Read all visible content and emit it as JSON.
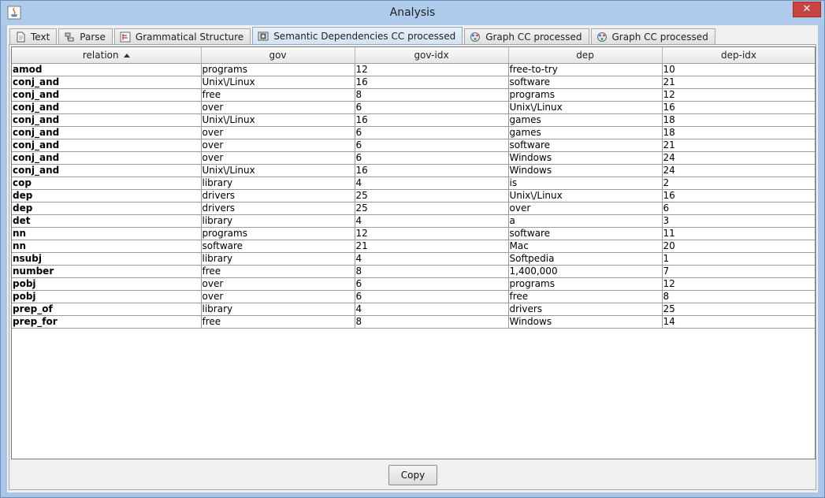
{
  "window": {
    "title": "Analysis",
    "close_label": "✕"
  },
  "tabs": [
    {
      "label": "Text",
      "icon": "document-icon",
      "active": false
    },
    {
      "label": "Parse",
      "icon": "parse-tree-icon",
      "active": false
    },
    {
      "label": "Grammatical Structure",
      "icon": "structure-icon",
      "active": false
    },
    {
      "label": "Semantic Dependencies CC processed",
      "icon": "dependencies-icon",
      "active": true
    },
    {
      "label": "Graph CC processed",
      "icon": "graph-icon",
      "active": false
    },
    {
      "label": "Graph CC processed",
      "icon": "graph-icon",
      "active": false
    }
  ],
  "table": {
    "columns": [
      "relation",
      "gov",
      "gov-idx",
      "dep",
      "dep-idx"
    ],
    "sort_column": "relation",
    "rows": [
      [
        "amod",
        "programs",
        "12",
        "free-to-try",
        "10"
      ],
      [
        "conj_and",
        "Unix\\/Linux",
        "16",
        "software",
        "21"
      ],
      [
        "conj_and",
        "free",
        "8",
        "programs",
        "12"
      ],
      [
        "conj_and",
        "over",
        "6",
        "Unix\\/Linux",
        "16"
      ],
      [
        "conj_and",
        "Unix\\/Linux",
        "16",
        "games",
        "18"
      ],
      [
        "conj_and",
        "over",
        "6",
        "games",
        "18"
      ],
      [
        "conj_and",
        "over",
        "6",
        "software",
        "21"
      ],
      [
        "conj_and",
        "over",
        "6",
        "Windows",
        "24"
      ],
      [
        "conj_and",
        "Unix\\/Linux",
        "16",
        "Windows",
        "24"
      ],
      [
        "cop",
        "library",
        "4",
        "is",
        "2"
      ],
      [
        "dep",
        "drivers",
        "25",
        "Unix\\/Linux",
        "16"
      ],
      [
        "dep",
        "drivers",
        "25",
        "over",
        "6"
      ],
      [
        "det",
        "library",
        "4",
        "a",
        "3"
      ],
      [
        "nn",
        "programs",
        "12",
        "software",
        "11"
      ],
      [
        "nn",
        "software",
        "21",
        "Mac",
        "20"
      ],
      [
        "nsubj",
        "library",
        "4",
        "Softpedia",
        "1"
      ],
      [
        "number",
        "free",
        "8",
        "1,400,000",
        "7"
      ],
      [
        "pobj",
        "over",
        "6",
        "programs",
        "12"
      ],
      [
        "pobj",
        "over",
        "6",
        "free",
        "8"
      ],
      [
        "prep_of",
        "library",
        "4",
        "drivers",
        "25"
      ],
      [
        "prep_for",
        "free",
        "8",
        "Windows",
        "14"
      ]
    ]
  },
  "footer": {
    "copy_label": "Copy"
  }
}
